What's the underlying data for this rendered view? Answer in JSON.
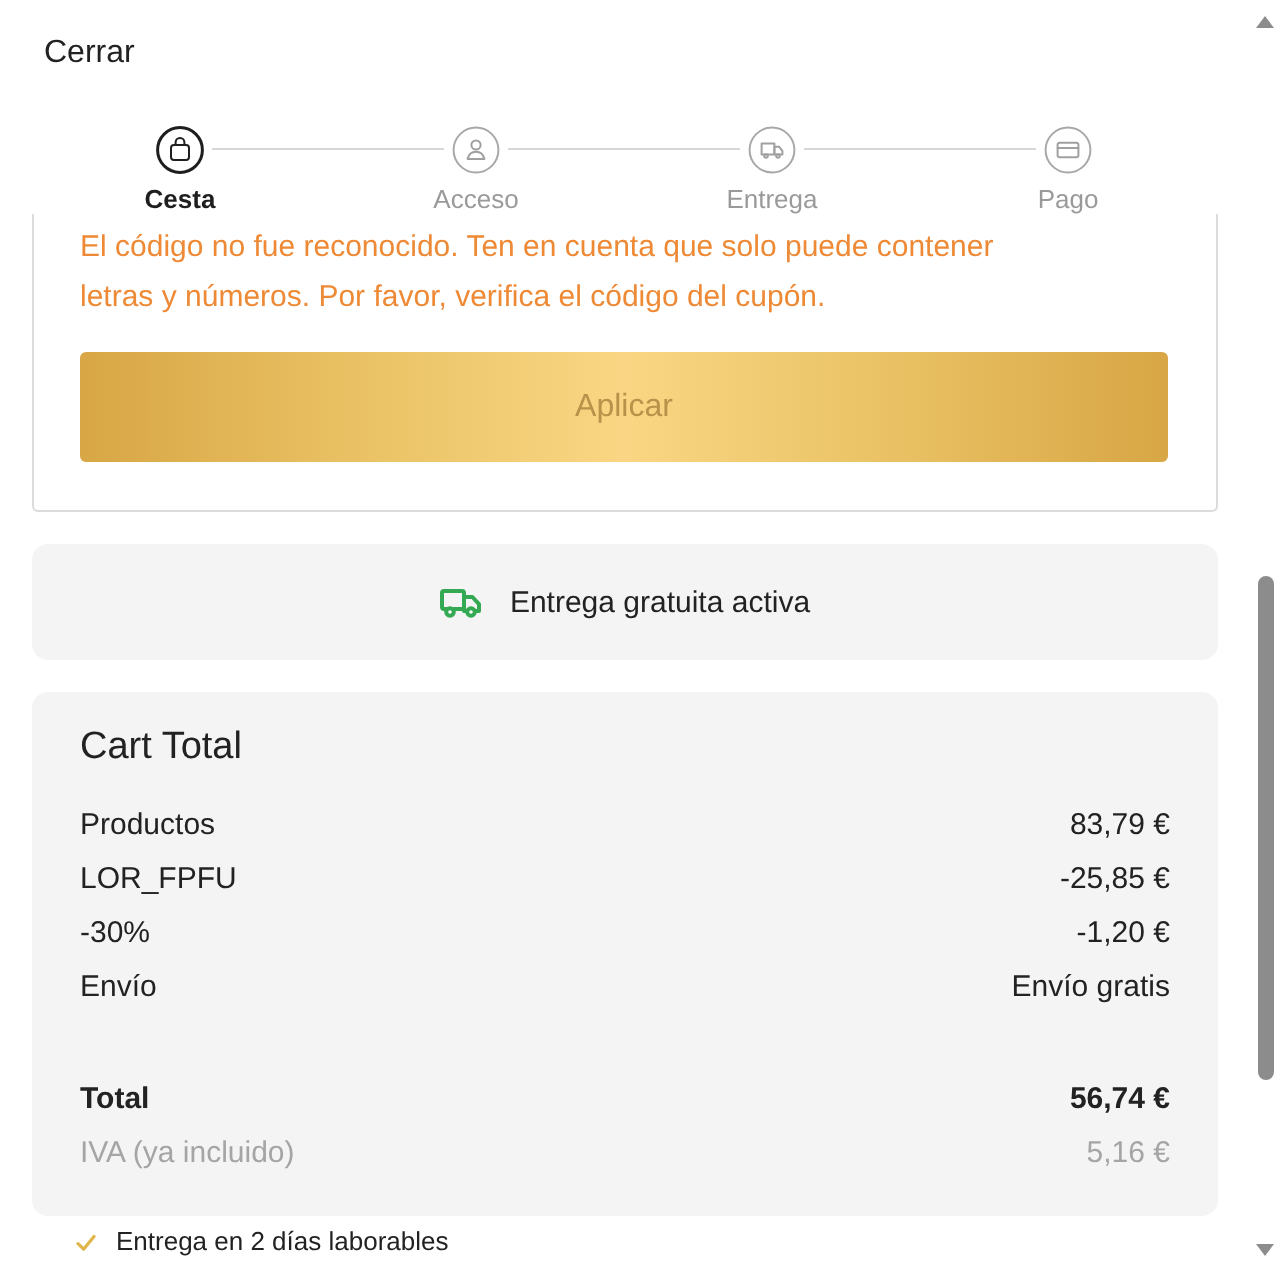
{
  "close_link": "Cerrar",
  "steps": [
    {
      "label": "Cesta",
      "selected": true
    },
    {
      "label": "Acceso",
      "selected": false
    },
    {
      "label": "Entrega",
      "selected": false
    },
    {
      "label": "Pago",
      "selected": false
    }
  ],
  "coupon": {
    "error": "El código no fue reconocido. Ten en cuenta que solo puede contener letras y números. Por favor, verifica el código del cupón.",
    "button": "Aplicar"
  },
  "delivery_banner": {
    "text": "Entrega gratuita activa"
  },
  "cart_total": {
    "title": "Cart Total",
    "rows": [
      {
        "label": "Productos",
        "value": "83,79 €"
      },
      {
        "label": "LOR_FPFU",
        "value": "-25,85 €"
      },
      {
        "label": "-30%",
        "value": "-1,20 €"
      },
      {
        "label": "Envío",
        "value": "Envío gratis"
      }
    ],
    "total": {
      "label": "Total",
      "value": "56,74 €"
    },
    "tax": {
      "label": "IVA (ya incluido)",
      "value": "5,16 €"
    }
  },
  "delivery_note": "Entrega en 2 días laborables"
}
